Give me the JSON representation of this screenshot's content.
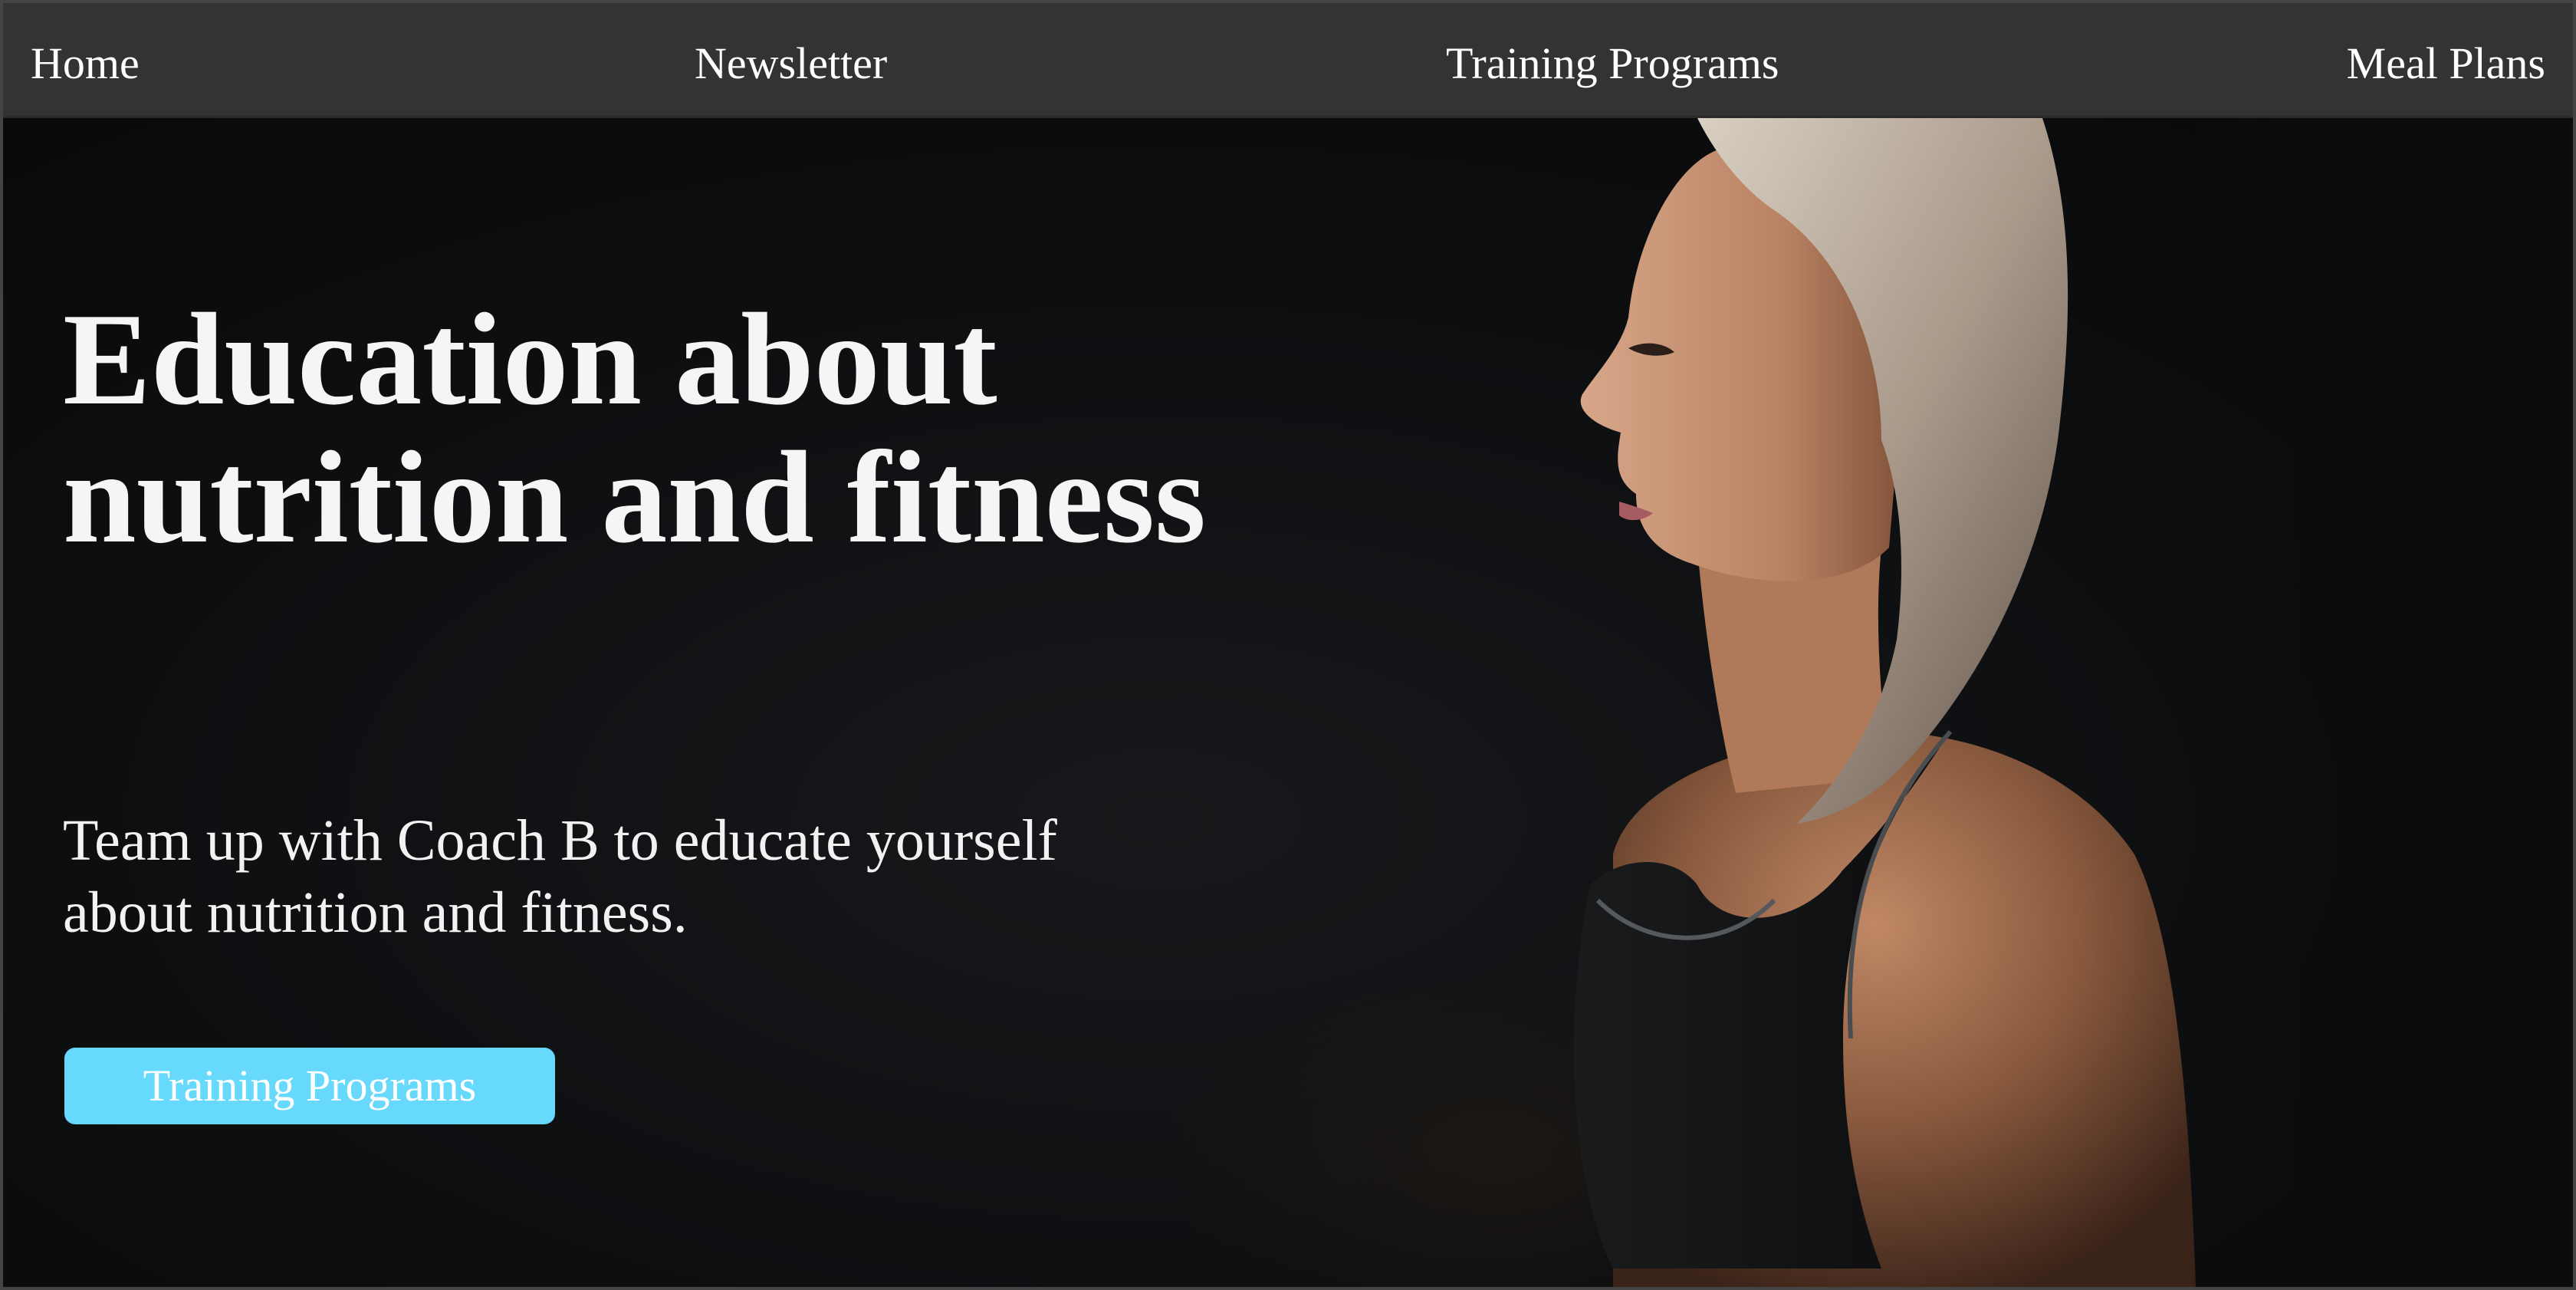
{
  "nav": {
    "items": [
      {
        "label": "Home"
      },
      {
        "label": "Newsletter"
      },
      {
        "label": "Training Programs"
      },
      {
        "label": "Meal Plans"
      }
    ]
  },
  "hero": {
    "title": "Education about nutrition and fitness",
    "subtitle": "Team up with Coach B to educate yourself about nutrition and fitness.",
    "cta_label": "Training Programs",
    "image_subject": "athlete-profile-photo"
  },
  "colors": {
    "nav_background": "#333333",
    "hero_background": "#0d0e10",
    "cta_background": "#66d9fd",
    "text": "#ffffff"
  }
}
